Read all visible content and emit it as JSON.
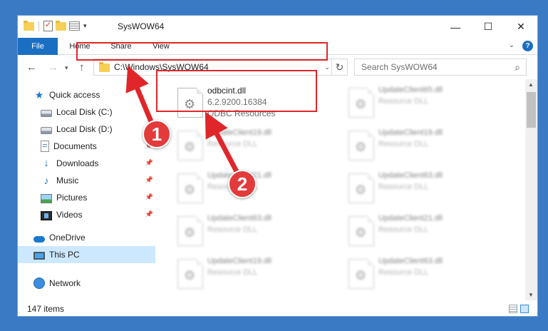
{
  "window": {
    "title": "SysWOW64",
    "controls": {
      "minimize": "—",
      "maximize": "☐",
      "close": "✕"
    }
  },
  "ribbon": {
    "tabs": [
      {
        "label": "File"
      },
      {
        "label": "Home"
      },
      {
        "label": "Share"
      },
      {
        "label": "View"
      }
    ],
    "help": "?"
  },
  "navbar": {
    "address": "C:\\Windows\\SysWOW64",
    "search_placeholder": "Search SysWOW64"
  },
  "sidebar": {
    "items": [
      {
        "label": "Quick access",
        "icon": "star-icon"
      },
      {
        "label": "Local Disk (C:)",
        "icon": "disk-icon"
      },
      {
        "label": "Local Disk (D:)",
        "icon": "disk-icon"
      },
      {
        "label": "Documents",
        "icon": "document-icon",
        "pinned": true
      },
      {
        "label": "Downloads",
        "icon": "download-icon",
        "pinned": true
      },
      {
        "label": "Music",
        "icon": "music-icon",
        "pinned": true
      },
      {
        "label": "Pictures",
        "icon": "pictures-icon",
        "pinned": true
      },
      {
        "label": "Videos",
        "icon": "video-icon",
        "pinned": true
      },
      {
        "label": "OneDrive",
        "icon": "cloud-icon"
      },
      {
        "label": "This PC",
        "icon": "pc-icon",
        "selected": true
      },
      {
        "label": "Network",
        "icon": "network-icon"
      }
    ]
  },
  "files": [
    {
      "name": "odbcint.dll",
      "version": "6.2.9200.16384",
      "description": "ODBC Resources",
      "highlighted": true
    },
    {
      "name": "UpdateClient65.dll",
      "description": "Resource DLL"
    },
    {
      "name": "UpdateClient19.dll",
      "description": "Resource DLL"
    },
    {
      "name": "UpdateClient19.dll",
      "description": "Resource DLL"
    },
    {
      "name": "UpdateClient21.dll",
      "description": "Resource DLL"
    },
    {
      "name": "UpdateClient63.dll",
      "description": "Resource DLL"
    },
    {
      "name": "UpdateClient63.dll",
      "description": "Resource DLL"
    },
    {
      "name": "UpdateClient21.dll",
      "description": "Resource DLL"
    },
    {
      "name": "UpdateClient19.dll",
      "description": "Resource DLL"
    },
    {
      "name": "UpdateClient63.dll",
      "description": "Resource DLL"
    }
  ],
  "status": {
    "item_count": "147 items"
  },
  "annotations": {
    "step1": "1",
    "step2": "2",
    "accent_color": "#e0262a"
  }
}
